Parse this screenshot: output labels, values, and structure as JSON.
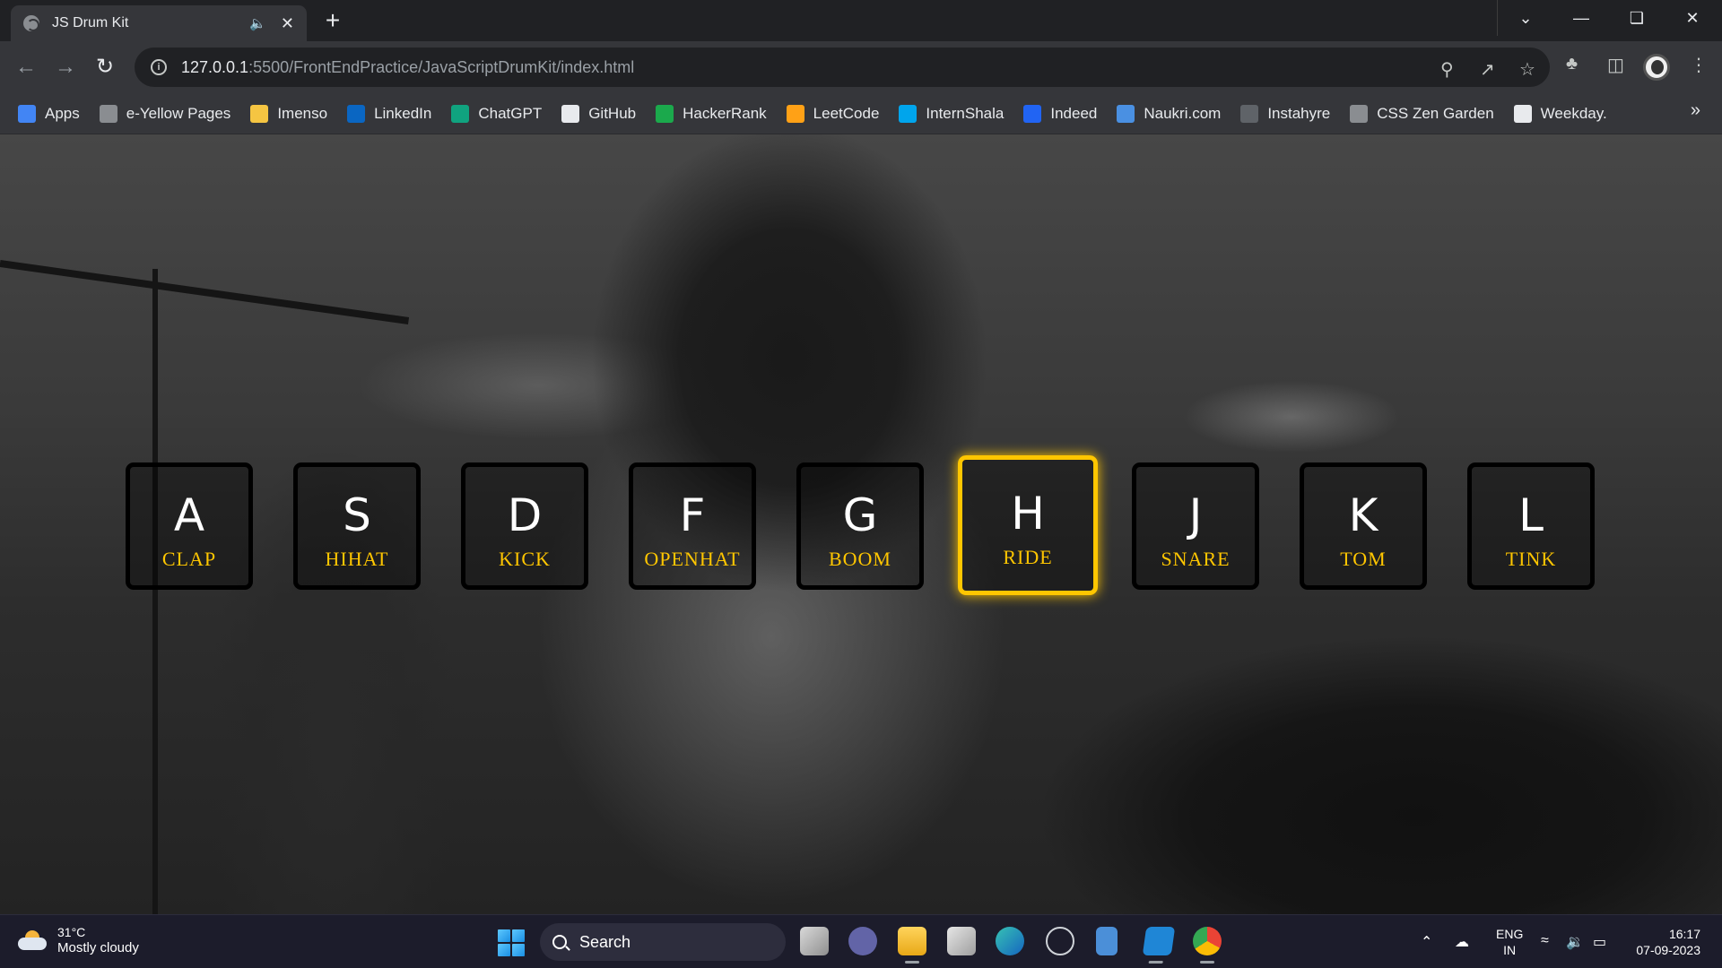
{
  "browser": {
    "tab_title": "JS Drum Kit",
    "new_tab_label": "+",
    "url_host": "127.0.0.1",
    "url_path": ":5500/FrontEndPractice/JavaScriptDrumKit/index.html"
  },
  "bookmarks": [
    {
      "label": "Apps",
      "icon": "apps-grid-icon",
      "color": "#4285f4"
    },
    {
      "label": "e-Yellow Pages",
      "icon": "globe-icon",
      "color": "#8a8d91"
    },
    {
      "label": "Imenso",
      "icon": "folder-icon",
      "color": "#f5c542"
    },
    {
      "label": "LinkedIn",
      "icon": "linkedin-icon",
      "color": "#0a66c2"
    },
    {
      "label": "ChatGPT",
      "icon": "chatgpt-icon",
      "color": "#10a37f"
    },
    {
      "label": "GitHub",
      "icon": "github-icon",
      "color": "#e8eaed"
    },
    {
      "label": "HackerRank",
      "icon": "hackerrank-icon",
      "color": "#1ba94c"
    },
    {
      "label": "LeetCode",
      "icon": "leetcode-icon",
      "color": "#ffa116"
    },
    {
      "label": "InternShala",
      "icon": "internshala-icon",
      "color": "#00a5ec"
    },
    {
      "label": "Indeed",
      "icon": "indeed-icon",
      "color": "#2164f3"
    },
    {
      "label": "Naukri.com",
      "icon": "naukri-icon",
      "color": "#4a90e2"
    },
    {
      "label": "Instahyre",
      "icon": "instahyre-icon",
      "color": "#5f6368"
    },
    {
      "label": "CSS Zen Garden",
      "icon": "globe-icon",
      "color": "#8a8d91"
    },
    {
      "label": "Weekday.",
      "icon": "weekday-icon",
      "color": "#e8eaed"
    }
  ],
  "drum_keys": [
    {
      "letter": "A",
      "sound": "CLAP",
      "playing": false
    },
    {
      "letter": "S",
      "sound": "HIHAT",
      "playing": false
    },
    {
      "letter": "D",
      "sound": "KICK",
      "playing": false
    },
    {
      "letter": "F",
      "sound": "OPENHAT",
      "playing": false
    },
    {
      "letter": "G",
      "sound": "BOOM",
      "playing": false
    },
    {
      "letter": "H",
      "sound": "RIDE",
      "playing": true
    },
    {
      "letter": "J",
      "sound": "SNARE",
      "playing": false
    },
    {
      "letter": "K",
      "sound": "TOM",
      "playing": false
    },
    {
      "letter": "L",
      "sound": "TINK",
      "playing": false
    }
  ],
  "colors": {
    "accent": "#ffc600",
    "key_border": "#000000",
    "chrome_dark": "#202124",
    "chrome_light": "#35363a"
  },
  "taskbar": {
    "temperature": "31°C",
    "condition": "Mostly cloudy",
    "search_label": "Search",
    "lang_top": "ENG",
    "lang_bottom": "IN",
    "time": "16:17",
    "date": "07-09-2023"
  }
}
